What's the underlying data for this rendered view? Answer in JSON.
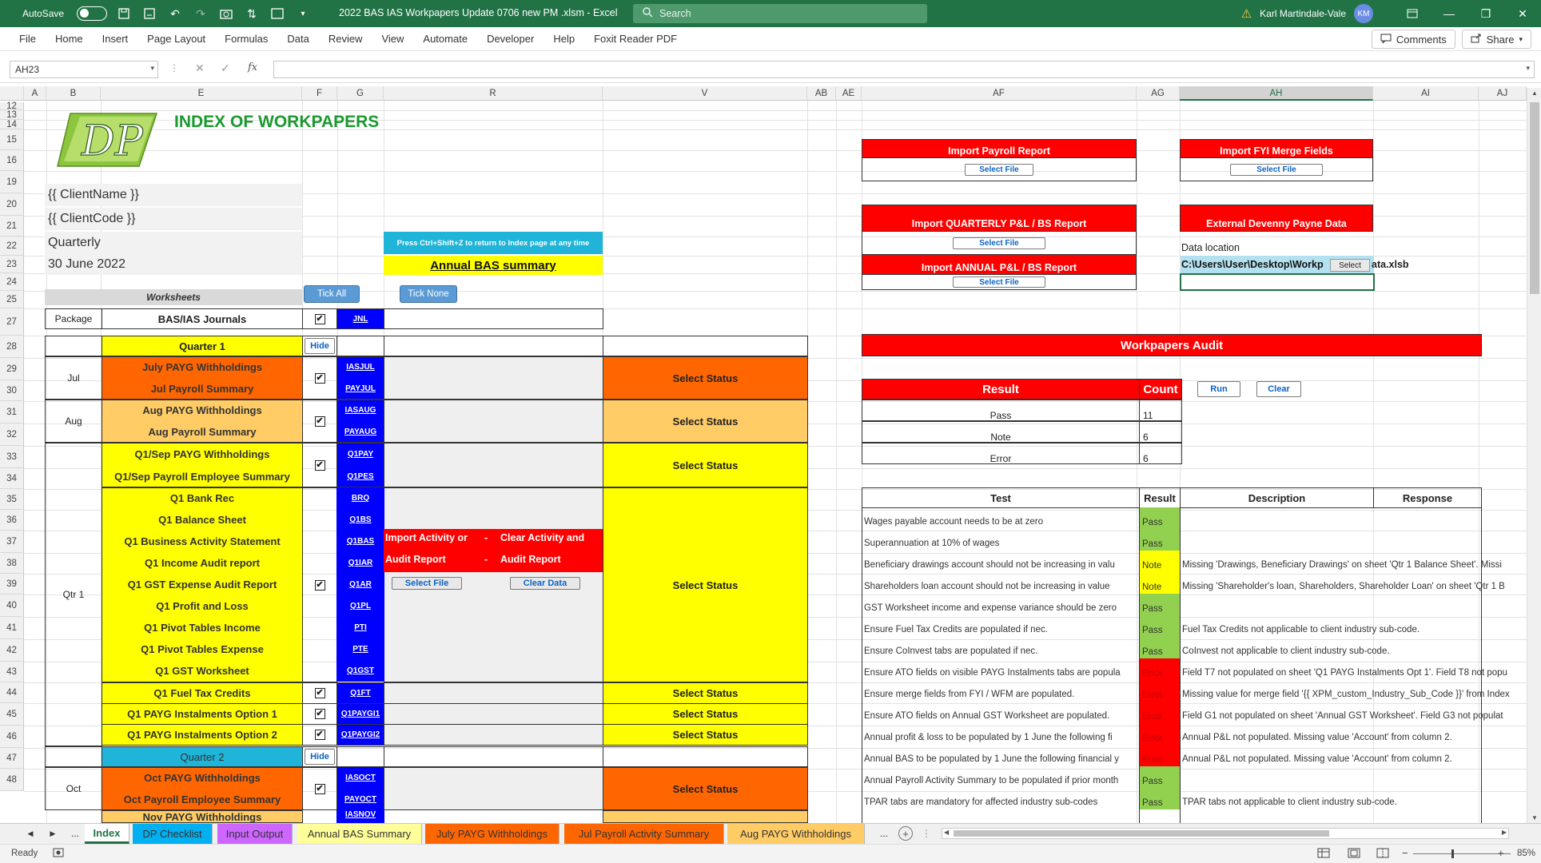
{
  "titlebar": {
    "autosave": "AutoSave",
    "doc_title": "2022 BAS IAS Workpapers Update 0706 new PM .xlsm  -  Excel",
    "search_placeholder": "Search",
    "user": "Karl Martindale-Vale",
    "initials": "KM"
  },
  "menu": [
    "File",
    "Home",
    "Insert",
    "Page Layout",
    "Formulas",
    "Data",
    "Review",
    "View",
    "Automate",
    "Developer",
    "Help",
    "Foxit Reader PDF"
  ],
  "menu_right": {
    "comments": "Comments",
    "share": "Share"
  },
  "formula": {
    "namebox": "AH23",
    "fx": "fx",
    "content": ""
  },
  "columns": [
    {
      "id": "A"
    },
    {
      "id": "B"
    },
    {
      "id": "E"
    },
    {
      "id": "F"
    },
    {
      "id": "G"
    },
    {
      "id": "R"
    },
    {
      "id": "V"
    },
    {
      "id": "AB"
    },
    {
      "id": "AE"
    },
    {
      "id": "AF"
    },
    {
      "id": "AG"
    },
    {
      "id": "AH"
    },
    {
      "id": "AI"
    },
    {
      "id": "AJ"
    }
  ],
  "rows": [
    "12",
    "13",
    "14",
    "15",
    "16",
    "19",
    "20",
    "21",
    "22",
    "23",
    "24",
    "25",
    "27",
    "28",
    "29",
    "30",
    "31",
    "32",
    "33",
    "34",
    "35",
    "36",
    "37",
    "38",
    "39",
    "40",
    "41",
    "42",
    "43",
    "44",
    "45",
    "46",
    "47",
    "48"
  ],
  "index": {
    "title": "INDEX OF WORKPAPERS",
    "logo_text": "DP",
    "client_name": "{{ ClientName }}",
    "client_code": "{{ ClientCode }}",
    "frequency": "Quarterly",
    "period": "30 June 2022",
    "shortcut_note": "Press Ctrl+Shift+Z to return to Index page at any time",
    "annual_bas": "Annual BAS summary",
    "worksheets": "Worksheets",
    "tick_all": "Tick All",
    "tick_none": "Tick None",
    "package": "Package",
    "journals": "BAS/IAS Journals",
    "jnl": "JNL",
    "check": "✔",
    "hide": "Hide",
    "select_status": "Select Status",
    "quarter1": "Quarter 1",
    "quarter2": "Quarter 2",
    "jul": "Jul",
    "aug": "Aug",
    "qtr1": "Qtr 1",
    "oct": "Oct",
    "items": {
      "jul_payg": "July PAYG Withholdings",
      "jul_payroll": "Jul Payroll Summary",
      "aug_payg": "Aug PAYG Withholdings",
      "aug_payroll": "Aug Payroll Summary",
      "q1_sep_payg": "Q1/Sep PAYG Withholdings",
      "q1_sep_payroll": "Q1/Sep Payroll  Employee Summary",
      "q1_bank": "Q1 Bank Rec",
      "q1_bs": "Q1 Balance Sheet",
      "q1_bas": "Q1 Business Activity Statement",
      "q1_income": "Q1 Income Audit report",
      "q1_gst_exp": "Q1 GST Expense Audit Report",
      "q1_pl": "Q1 Profit and Loss",
      "q1_pti": "Q1 Pivot Tables Income",
      "q1_pte": "Q1 Pivot Tables Expense",
      "q1_gst": "Q1 GST Worksheet",
      "q1_ftc": "Q1 Fuel Tax Credits",
      "q1_payg1": "Q1 PAYG Instalments Option 1",
      "q1_payg2": "Q1 PAYG Instalments Option 2",
      "oct_payg": "Oct PAYG Withholdings",
      "oct_payroll": "Oct Payroll Employee Summary",
      "nov_payg": "Nov PAYG Withholdings"
    },
    "codes": {
      "iasjul": "IASJUL",
      "payjul": "PAYJUL",
      "iasaug": "IASAUG",
      "payaug": "PAYAUG",
      "q1pay": "Q1PAY",
      "q1pes": "Q1PES",
      "brq": "BRQ",
      "q1bs": "Q1BS",
      "q1bas": "Q1BAS",
      "q1iar": "Q1IAR",
      "q1ar": "Q1AR",
      "q1pl": "Q1PL",
      "pti": "PTI",
      "pte": "PTE",
      "q1gst": "Q1GST",
      "q1ft": "Q1FT",
      "q1paygi1": "Q1PAYGI1",
      "q1paygi2": "Q1PAYGI2",
      "iasoct": "IASOCT",
      "payoct": "PAYOCT",
      "iasnov": "IASNOV"
    },
    "import_activity_1": "Import Activity or",
    "import_activity_2": "Audit Report",
    "clear_activity_1": "Clear Activity and",
    "clear_activity_2": "Audit Report",
    "dash": "-",
    "select_file": "Select File",
    "clear_data": "Clear Data"
  },
  "imports": {
    "payroll": "Import Payroll Report",
    "fyi": "Import FYI Merge Fields",
    "quarterly": "Import QUARTERLY P&L / BS Report",
    "external": "External Devenny Payne Data",
    "annual": "Import ANNUAL P&L / BS Report",
    "data_location": "Data location",
    "path": "C:\\Users\\User\\Desktop\\Workp",
    "path_tail": "ata.xlsb",
    "select": "Select",
    "select_file": "Select File"
  },
  "audit": {
    "title": "Workpapers Audit",
    "result_hdr": "Result",
    "count_hdr": "Count",
    "run": "Run",
    "clear": "Clear",
    "summary": [
      {
        "label": "Pass",
        "count": "11"
      },
      {
        "label": "Note",
        "count": "6"
      },
      {
        "label": "Error",
        "count": "6"
      }
    ],
    "test_hdr": "Test",
    "result_col": "Result",
    "desc_hdr": "Description",
    "resp_hdr": "Response",
    "rows": [
      {
        "test": "Wages payable account needs to be at zero",
        "result": "Pass",
        "desc": ""
      },
      {
        "test": "Superannuation at 10% of wages",
        "result": "Pass",
        "desc": ""
      },
      {
        "test": "Beneficiary drawings account should not be increasing in valu",
        "result": "Note",
        "desc": "Missing 'Drawings, Beneficiary Drawings' on sheet 'Qtr 1 Balance Sheet'. Missi"
      },
      {
        "test": "Shareholders loan account should not be increasing in value",
        "result": "Note",
        "desc": "Missing 'Shareholder's loan, Shareholders, Shareholder Loan' on sheet 'Qtr 1 B"
      },
      {
        "test": "GST Worksheet income and expense variance should be zero",
        "result": "Pass",
        "desc": ""
      },
      {
        "test": "Ensure Fuel Tax Credits are populated if nec.",
        "result": "Pass",
        "desc": "Fuel Tax Credits not applicable to client industry sub-code."
      },
      {
        "test": "Ensure CoInvest tabs are populated if nec.",
        "result": "Pass",
        "desc": "CoInvest not applicable to client industry sub-code."
      },
      {
        "test": "Ensure ATO fields on visible PAYG Instalments tabs are popula",
        "result": "Error",
        "desc": "Field T7 not populated on sheet 'Q1 PAYG Instalments Opt 1'. Field T8 not popu"
      },
      {
        "test": "Ensure merge fields from FYI / WFM are populated.",
        "result": "Error",
        "desc": "Missing value for merge field '{{ XPM_custom_Industry_Sub_Code }}' from Index"
      },
      {
        "test": "Ensure ATO fields on Annual GST Worksheet are populated.",
        "result": "Error",
        "desc": "Field G1 not populated on sheet 'Annual GST Worksheet'. Field G3 not populat"
      },
      {
        "test": "Annual profit & loss to be populated by 1 June the following fi",
        "result": "Error",
        "desc": "Annual P&L not populated.  Missing value 'Account' from column 2."
      },
      {
        "test": "Annual BAS to be populated by 1 June the following financial y",
        "result": "Error",
        "desc": "Annual P&L not populated.  Missing value 'Account' from column 2."
      },
      {
        "test": "Annual Payroll Activity Summary to be populated if prior month",
        "result": "Pass",
        "desc": ""
      },
      {
        "test": "TPAR tabs are mandatory for affected industry sub-codes",
        "result": "Pass",
        "desc": "TPAR tabs not applicable to client industry sub-code."
      }
    ]
  },
  "tabs": [
    {
      "label": "Index",
      "color": "#ffffff",
      "active": true
    },
    {
      "label": "DP Checklist",
      "color": "#00b0f0"
    },
    {
      "label": "Input Output",
      "color": "#cc66ff"
    },
    {
      "label": "Annual BAS Summary",
      "color": "#ffff99"
    },
    {
      "label": "July PAYG Withholdings",
      "color": "#ff6600"
    },
    {
      "label": "Jul Payroll Activity Summary",
      "color": "#ff6600"
    },
    {
      "label": "Aug PAYG Withholdings",
      "color": "#ffcc66"
    }
  ],
  "tabnav": {
    "prev": "◀",
    "next": "▶",
    "ellipsis": "...",
    "more": "...",
    "add": "+"
  },
  "status": {
    "ready": "Ready",
    "zoom": "85%"
  },
  "colors": {
    "excel_green": "#217346",
    "red": "#ff0000",
    "yellow": "#ffff00",
    "orange": "#ff6600",
    "light_orange": "#ffcc66",
    "blue_code": "#0000ff",
    "cyan": "#00b0f0",
    "pass": "#92d050",
    "note": "#ffff00",
    "error": "#ff0000"
  }
}
